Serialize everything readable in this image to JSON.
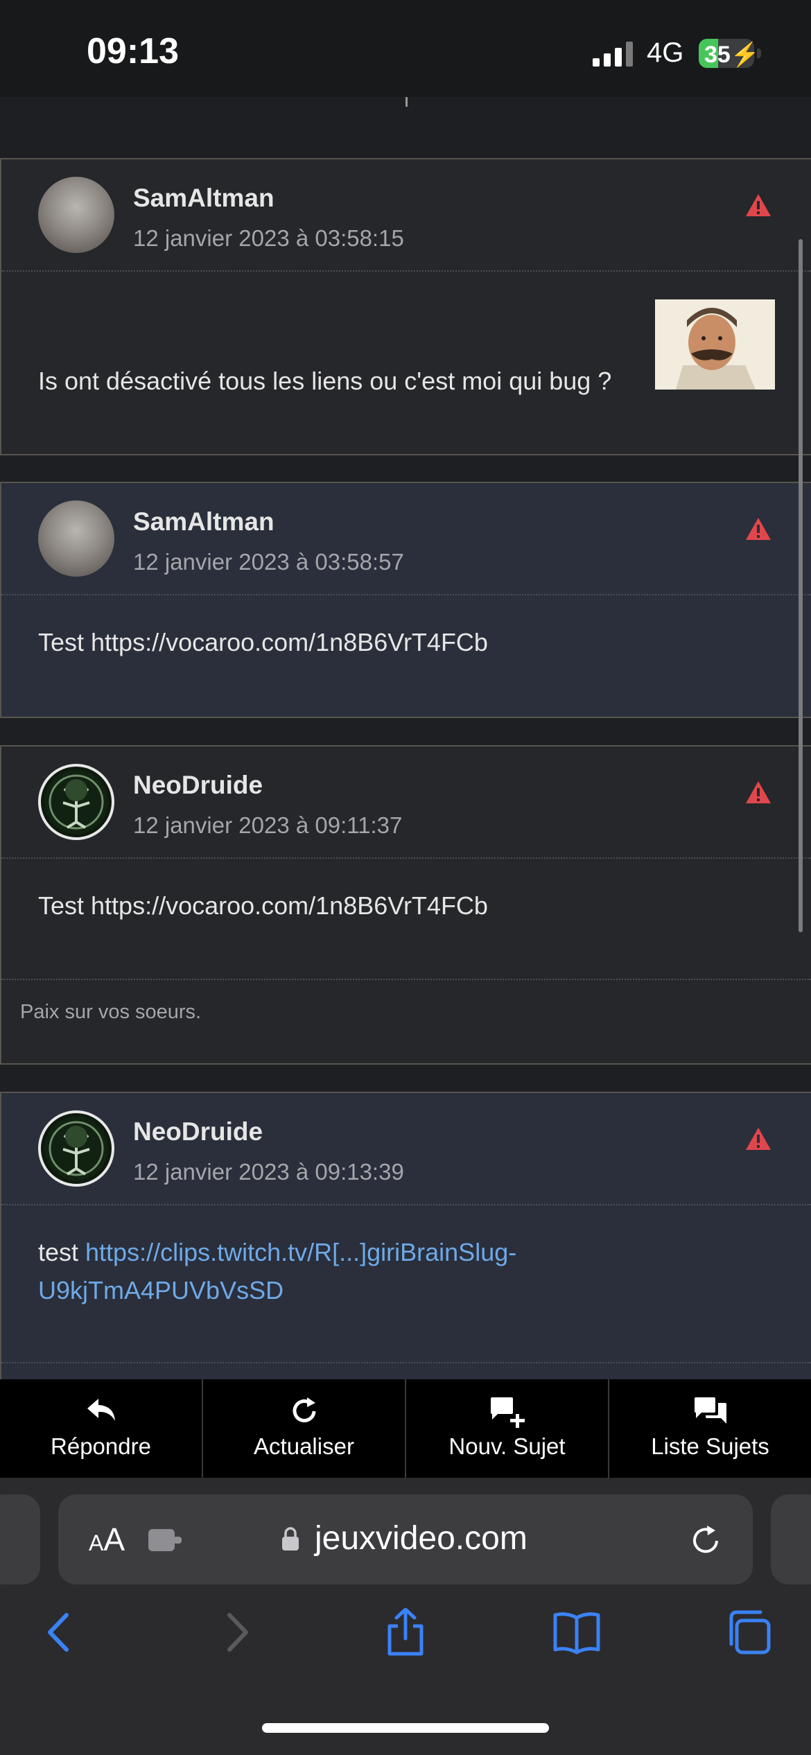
{
  "status": {
    "time": "09:13",
    "network": "4G",
    "battery": "35",
    "battery_level": 0.35
  },
  "posts": [
    {
      "author": "SamAltman",
      "date": "12 janvier 2023 à 03:58:15",
      "text": "Is ont désactivé tous les liens ou c'est moi qui bug ?"
    },
    {
      "author": "SamAltman",
      "date": "12 janvier 2023 à 03:58:57",
      "text": "Test https://vocaroo.com/1n8B6VrT4FCb"
    },
    {
      "author": "NeoDruide",
      "date": "12 janvier 2023 à 09:11:37",
      "text": "Test https://vocaroo.com/1n8B6VrT4FCb",
      "signature": "Paix sur vos soeurs."
    },
    {
      "author": "NeoDruide",
      "date": "12 janvier 2023 à 09:13:39",
      "text_prefix": "test ",
      "link_line1": "https://clips.twitch.tv/R[...]giriBrainSlug-",
      "link_line2": "U9kjTmA4PUVbVsSD"
    }
  ],
  "toolbar": {
    "reply": "Répondre",
    "refresh": "Actualiser",
    "new_topic": "Nouv. Sujet",
    "topic_list": "Liste Sujets"
  },
  "browser": {
    "aa_big": "A",
    "aa_small": "A",
    "url": "jeuxvideo.com"
  },
  "colors": {
    "accent_link": "#6fa9e8",
    "alert": "#e0474c",
    "battery": "#47c55a",
    "nav_blue": "#3b82f6"
  },
  "icons": [
    "alert-icon",
    "reply-icon",
    "refresh-icon",
    "new-topic-icon",
    "topic-list-icon",
    "lock-icon",
    "reload-icon",
    "back-icon",
    "forward-icon",
    "share-icon",
    "bookmarks-icon",
    "tabs-icon"
  ]
}
